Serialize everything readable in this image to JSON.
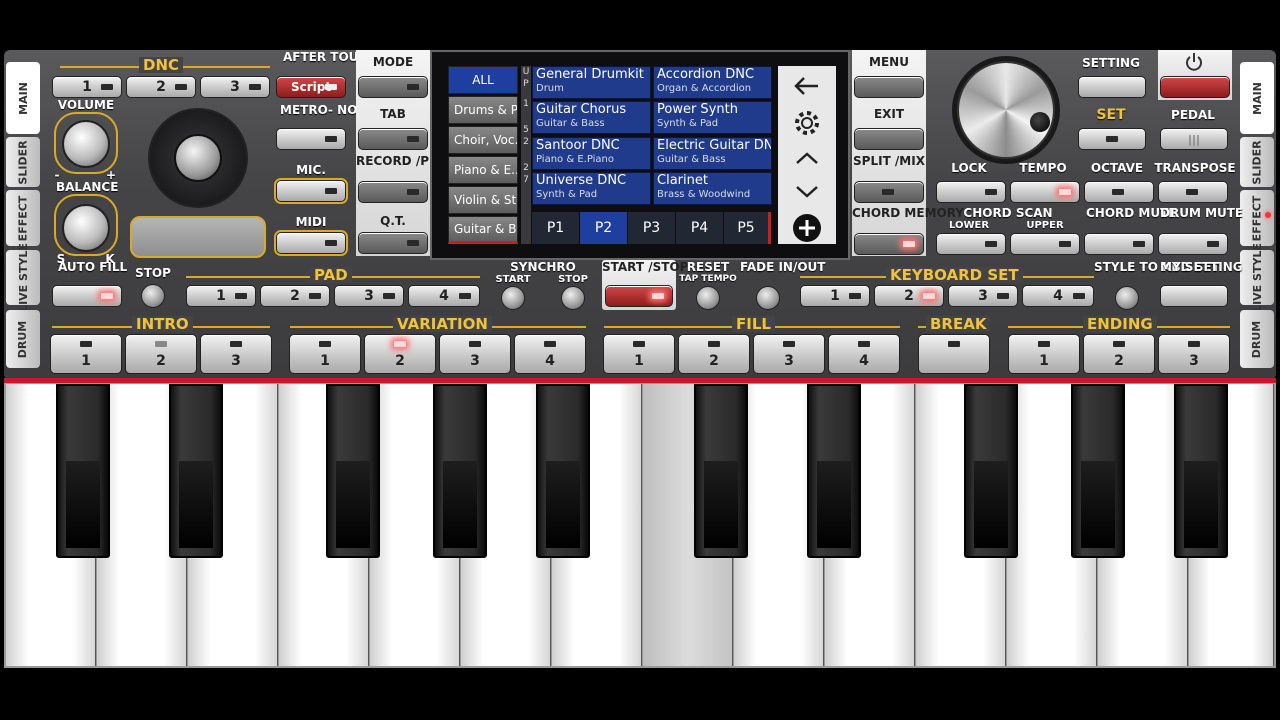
{
  "side_tabs": {
    "main": "MAIN",
    "slider": "SLIDER",
    "effect": "EFFECT",
    "live_style": "LIVE STYLE",
    "drum": "DRUM"
  },
  "dnc": {
    "label": "DNC",
    "buttons": [
      "1",
      "2",
      "3"
    ],
    "script": "Script"
  },
  "after_touch": "AFTER TOUCH",
  "volume": "VOLUME",
  "balance": "BALANCE",
  "balance_marks": {
    "minus": "-",
    "plus": "+",
    "s": "S",
    "k": "K"
  },
  "metronome": "METRO- NOME",
  "mic": "MIC.",
  "midi": "MIDI",
  "mode": "MODE",
  "tab": "TAB",
  "record_play": "RECORD /PLAY",
  "qt": "Q.T.",
  "screen": {
    "categories": [
      "ALL",
      "Drums & P...",
      "Choir, Voc...",
      "Piano & E...",
      "Violin & St...",
      "Guitar & B..."
    ],
    "up_indicator": [
      "U",
      "P",
      "1",
      "5",
      "2",
      "2",
      "7"
    ],
    "styles": [
      {
        "name": "General Drumkit",
        "cat": "Drum"
      },
      {
        "name": "Accordion DNC",
        "cat": "Organ & Accordion"
      },
      {
        "name": "Guitar Chorus",
        "cat": "Guitar & Bass"
      },
      {
        "name": "Power Synth",
        "cat": "Synth & Pad"
      },
      {
        "name": "Santoor DNC",
        "cat": "Piano & E.Piano"
      },
      {
        "name": "Electric Guitar DNC",
        "cat": "Guitar & Bass"
      },
      {
        "name": "Universe DNC",
        "cat": "Synth & Pad"
      },
      {
        "name": "Clarinet",
        "cat": "Brass & Woodwind"
      }
    ],
    "pages": [
      "P1",
      "P2",
      "P3",
      "P4",
      "P5"
    ],
    "selected_page": "P2",
    "icons": [
      "back-arrow-icon",
      "gear-icon",
      "chevron-up-icon",
      "chevron-down-icon",
      "add-circle-icon"
    ]
  },
  "menu": "MENU",
  "exit": "EXIT",
  "split_mix": "SPLIT /MIX",
  "chord_memory": "CHORD MEMORY",
  "setting": "SETTING",
  "set": "SET",
  "pedal": "PEDAL",
  "power": "power-icon",
  "lock": "LOCK",
  "tempo": "TEMPO",
  "octave": "OCTAVE",
  "transpose": "TRANSPOSE",
  "chord_scan": "CHORD SCAN",
  "chord_scan_lower": "LOWER",
  "chord_scan_upper": "UPPER",
  "chord_mute": "CHORD MUTE",
  "drum_mute": "DRUM MUTE",
  "auto_fill": "AUTO FILL",
  "stop": "STOP",
  "pad": {
    "label": "PAD",
    "buttons": [
      "1",
      "2",
      "3",
      "4"
    ]
  },
  "synchro": "SYNCHRO",
  "synchro_start": "START",
  "synchro_stop": "STOP",
  "start_stop": "START /STOP",
  "reset": "RESET",
  "tap_tempo": "TAP TEMPO",
  "fade": "FADE IN/OUT",
  "keyboard_set": {
    "label": "KEYBOARD SET",
    "buttons": [
      "1",
      "2",
      "3",
      "4"
    ]
  },
  "style_to_kbd": "STYLE TO KBD SET",
  "my_setting": "MY SETTING",
  "intro": {
    "label": "INTRO",
    "buttons": [
      "1",
      "2",
      "3"
    ]
  },
  "variation": {
    "label": "VARIATION",
    "buttons": [
      "1",
      "2",
      "3",
      "4"
    ]
  },
  "fill": {
    "label": "FILL",
    "buttons": [
      "1",
      "2",
      "3",
      "4"
    ]
  },
  "break": {
    "label": "BREAK"
  },
  "ending": {
    "label": "ENDING",
    "buttons": [
      "1",
      "2",
      "3"
    ]
  },
  "colors": {
    "accent_gold": "#f2c23a",
    "screen_blue": "#1f3fa0",
    "led_red": "#ff7070",
    "keyboard_line": "#c8182c"
  }
}
